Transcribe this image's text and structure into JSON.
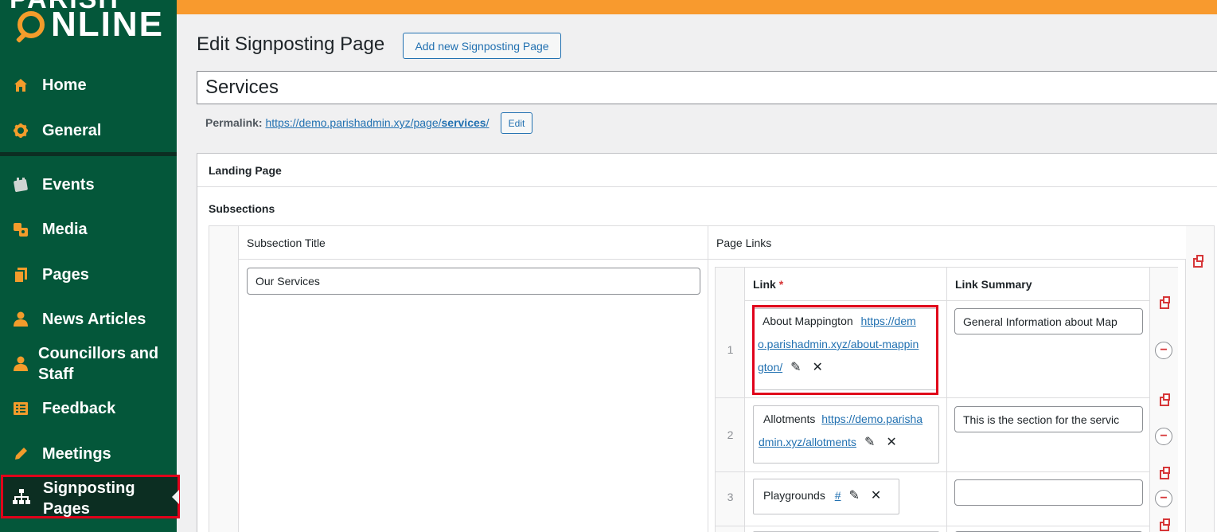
{
  "brand": {
    "logo_top": "PARISH",
    "logo_main": "NLINE",
    "accent_color": "#f89a2e",
    "sidebar_color": "#04573a"
  },
  "sidebar": {
    "items": [
      {
        "label": "Home",
        "icon": "home-icon"
      },
      {
        "label": "General",
        "icon": "gear-icon"
      },
      {
        "label": "Events",
        "icon": "calendar-icon"
      },
      {
        "label": "Media",
        "icon": "media-icon"
      },
      {
        "label": "Pages",
        "icon": "pages-icon"
      },
      {
        "label": "News Articles",
        "icon": "user-icon"
      },
      {
        "label": "Councillors and Staff",
        "icon": "user-icon"
      },
      {
        "label": "Feedback",
        "icon": "feedback-icon"
      },
      {
        "label": "Meetings",
        "icon": "pencil-icon"
      },
      {
        "label": "Signposting Pages",
        "icon": "sitemap-icon"
      }
    ]
  },
  "header": {
    "title": "Edit Signposting Page",
    "add_button": "Add new Signposting Page"
  },
  "page": {
    "title_value": "Services",
    "permalink_label": "Permalink:",
    "permalink_base": "https://demo.parishadmin.xyz/page/",
    "permalink_slug": "services",
    "permalink_end": "/",
    "edit_button": "Edit"
  },
  "landing": {
    "heading": "Landing Page",
    "subsections_label": "Subsections",
    "col_subsection_title": "Subsection Title",
    "col_page_links": "Page Links",
    "subsection_value": "Our Services"
  },
  "links_table": {
    "col_link": "Link",
    "required_mark": "*",
    "col_summary": "Link Summary",
    "rows": [
      {
        "num": "1",
        "title": "About Mappington",
        "url_lines": [
          "https://dem",
          "o.parishadmin.xyz/about-mappin",
          "gton/"
        ],
        "summary": "General Information about Map"
      },
      {
        "num": "2",
        "title": "Allotments",
        "url_lines": [
          "https://demo.parisha",
          "dmin.xyz/allotments"
        ],
        "summary": "This is the section for the servic"
      },
      {
        "num": "3",
        "title": "Playgrounds",
        "url_lines": [
          "#"
        ],
        "summary": ""
      }
    ],
    "edit_glyph": "✎",
    "remove_glyph": "✕",
    "minus_glyph": "−"
  }
}
